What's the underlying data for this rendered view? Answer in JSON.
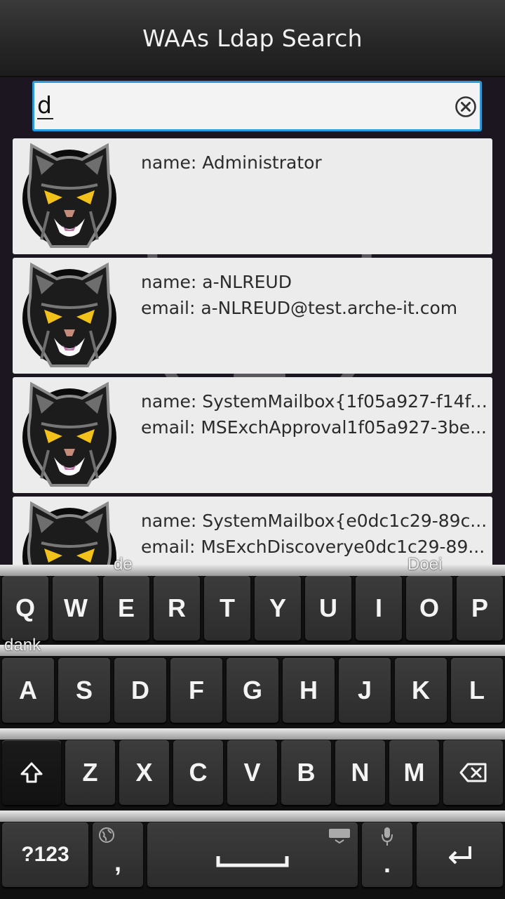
{
  "app": {
    "title": "WAAs Ldap Search"
  },
  "search": {
    "value": "d"
  },
  "results": [
    {
      "name": "name: Administrator",
      "email": ""
    },
    {
      "name": "name: a-NLREUD",
      "email": "email: a-NLREUD@test.arche-it.com"
    },
    {
      "name": "name: SystemMailbox{1f05a927-f14f-...",
      "email": "email: MSExchApproval1f05a927-3be..."
    },
    {
      "name": "name: SystemMailbox{e0dc1c29-89c...",
      "email": "email: MsExchDiscoverye0dc1c29-89..."
    }
  ],
  "keyboard": {
    "suggestions": [
      "de",
      "Doei",
      "dank"
    ],
    "row1": [
      "Q",
      "W",
      "E",
      "R",
      "T",
      "Y",
      "U",
      "I",
      "O",
      "P"
    ],
    "row2": [
      "A",
      "S",
      "D",
      "F",
      "G",
      "H",
      "J",
      "K",
      "L"
    ],
    "row3": [
      "Z",
      "X",
      "C",
      "V",
      "B",
      "N",
      "M"
    ],
    "symbols_label": "?123",
    "comma_label": ",",
    "period_label": "."
  },
  "colors": {
    "accent": "#2a9ad9",
    "card": "#ececec",
    "titlebar": "#2a2a2a"
  },
  "icons": [
    "clear-icon",
    "globe-icon",
    "keyboard-hide-icon",
    "microphone-icon",
    "shift-icon",
    "backspace-icon",
    "enter-icon",
    "space-icon"
  ]
}
